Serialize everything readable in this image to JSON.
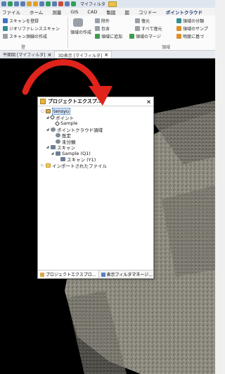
{
  "quick_access": {
    "filter_label": "マイフィルタ"
  },
  "ribbon_tabs": [
    "ファイル",
    "ホーム",
    "測量",
    "GIS",
    "CAD",
    "製図",
    "図",
    "コリドー",
    "ポイントクラウド"
  ],
  "ribbon": {
    "register_scan": "スキャンを登録",
    "georeference_scan": "ジオリファレンススキャン",
    "scan_measure": "スキャン測線の作成",
    "region_create": "領域の作成",
    "exclude": "除外",
    "include": "包含",
    "add_to_region": "領域に追加",
    "restore": "復元",
    "restore_all": "すべて復元",
    "merge_region": "領域のマージ",
    "region_classify": "領域の分類",
    "region_sample": "領域のサンプ",
    "brightness_based": "明度に基づ",
    "group_register": "登",
    "group_region": "領域"
  },
  "doc_tabs": [
    {
      "label": "平面図 [マイフィルタ]",
      "active": false
    },
    {
      "label": "3D表示 [マイフィルタ]",
      "active": true
    }
  ],
  "panel": {
    "title": "プロジェクトエクスプ...",
    "tree": [
      {
        "label": "tensyu",
        "level": 0,
        "icon": "project-icon",
        "toggle": "▢"
      },
      {
        "label": "ポイント",
        "level": 1,
        "icon": "point-icon",
        "toggle": "◢"
      },
      {
        "label": "Sample",
        "level": 2,
        "icon": "point-icon",
        "toggle": ""
      },
      {
        "label": "ポイントクラウド領域",
        "level": 1,
        "icon": "pointcloud-icon",
        "toggle": "◢"
      },
      {
        "label": "既定",
        "level": 2,
        "icon": "cloud-icon",
        "toggle": ""
      },
      {
        "label": "未分類",
        "level": 2,
        "icon": "cloud-icon",
        "toggle": ""
      },
      {
        "label": "スキャン",
        "level": 1,
        "icon": "scan-icon",
        "toggle": "◢"
      },
      {
        "label": "Sample (Q1)",
        "level": 2,
        "icon": "scan-icon",
        "toggle": "◢"
      },
      {
        "label": "スキャン (Y1)",
        "level": 3,
        "icon": "scan-icon",
        "toggle": ""
      },
      {
        "label": "インポートされたファイル",
        "level": 1,
        "icon": "folder-icon",
        "toggle": "▷"
      }
    ],
    "footer_tabs": [
      {
        "label": "プロジェクトエクスプロ...",
        "active": true
      },
      {
        "label": "表示フィルタマネージ...",
        "active": false
      }
    ]
  },
  "colors": {
    "annotation_arrow": "#e0241b",
    "viewport_bg": "#000000"
  }
}
